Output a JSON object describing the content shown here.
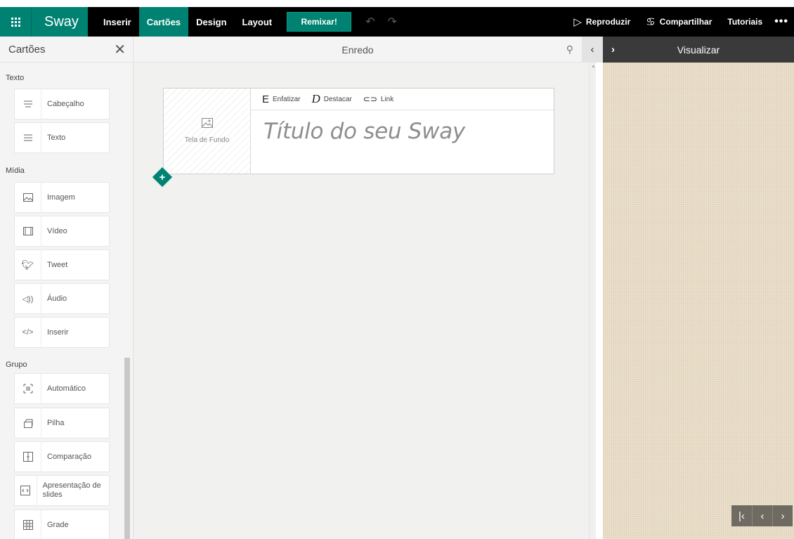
{
  "topbar": {
    "brand": "Sway",
    "nav": [
      "Inserir",
      "Cartões",
      "Design",
      "Layout"
    ],
    "active_nav": "Cartões",
    "remix_label": "Remixar!",
    "play_label": "Reproduzir",
    "share_label": "Compartilhar",
    "tutorials_label": "Tutoriais",
    "more_label": "•••"
  },
  "cards_panel": {
    "title": "Cartões",
    "sections": [
      {
        "label": "Texto",
        "items": [
          {
            "label": "Cabeçalho",
            "icon": "heading-icon"
          },
          {
            "label": "Texto",
            "icon": "text-icon"
          }
        ]
      },
      {
        "label": "Mídia",
        "items": [
          {
            "label": "Imagem",
            "icon": "image-icon"
          },
          {
            "label": "Vídeo",
            "icon": "video-icon"
          },
          {
            "label": "Tweet",
            "icon": "twitter-icon"
          },
          {
            "label": "Áudio",
            "icon": "audio-icon"
          },
          {
            "label": "Inserir",
            "icon": "embed-icon"
          }
        ]
      },
      {
        "label": "Grupo",
        "items": [
          {
            "label": "Automático",
            "icon": "automatic-group-icon"
          },
          {
            "label": "Pilha",
            "icon": "stack-icon"
          },
          {
            "label": "Comparação",
            "icon": "comparison-icon"
          },
          {
            "label": "Apresentação de slides",
            "icon": "slideshow-icon"
          },
          {
            "label": "Grade",
            "icon": "grid-icon"
          }
        ]
      }
    ]
  },
  "storyline": {
    "title": "Enredo",
    "background_label": "Tela de Fundo",
    "toolbar": {
      "emphasize": "Enfatizar",
      "accent": "Destacar",
      "link": "Link"
    },
    "title_placeholder": "Título do seu Sway"
  },
  "preview": {
    "title": "Visualizar"
  },
  "colors": {
    "accent": "#008272",
    "topbar_bg": "#000000",
    "preview_bg": "#e8dcc6"
  }
}
